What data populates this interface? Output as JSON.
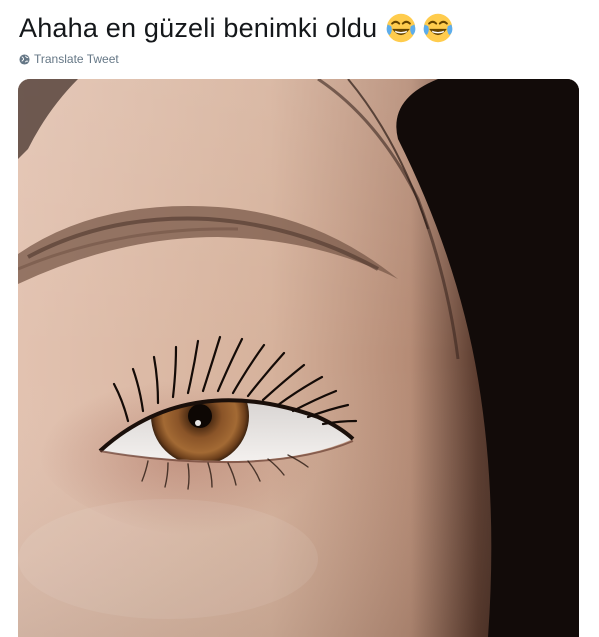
{
  "tweet": {
    "text": "Ahaha en güzeli benimki oldu",
    "emojis": [
      "face-with-tears-of-joy-icon",
      "face-with-tears-of-joy-icon"
    ],
    "translate_label": "Translate Tweet",
    "translate_icon": "globe-icon"
  },
  "colors": {
    "text": "#14171a",
    "secondary": "#657786",
    "emoji_face": "#ffcc4d",
    "emoji_tears": "#5dadec",
    "iris": "#7a4a22",
    "skin": "#d9b7a3"
  }
}
